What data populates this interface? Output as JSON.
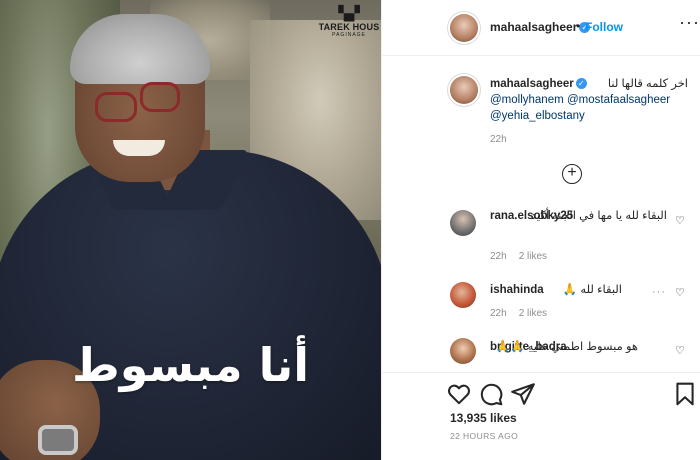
{
  "image": {
    "overlay_text": "أنا مبسوط",
    "logo": {
      "mark": "▚▞",
      "brand": "TAREK HOUS",
      "sub": "PAGINAGE"
    }
  },
  "header": {
    "username": "mahaalsagheer",
    "verified_icon": "verified-badge-icon",
    "follow_label": "Follow",
    "separator": "•",
    "more_label": "···"
  },
  "caption": {
    "username": "mahaalsagheer",
    "text": "اخر كلمه قالها لنا",
    "mentions": [
      "@mollyhanem",
      "@mostafaalsagheer",
      "@yehia_elbostany"
    ],
    "time": "22h"
  },
  "load_more": "+",
  "comments": [
    {
      "username": "rana.elsobky25",
      "text": "البقاء لله يا مها في الجنة أكيد",
      "time": "22h",
      "likes": "2 likes"
    },
    {
      "username": "ishahinda",
      "text": "البقاء لله 🙏",
      "time": "22h",
      "likes": "2 likes"
    },
    {
      "username": "brigitte_badra",
      "text": "هو مبسوط اطمني عليه 🙏🙏",
      "time": "",
      "likes": ""
    }
  ],
  "actions": {
    "likes": "13,935 likes",
    "posted": "22 HOURS AGO"
  },
  "colors": {
    "accent": "#0095f6",
    "mention": "#00376b",
    "muted": "#8e8e8e"
  }
}
